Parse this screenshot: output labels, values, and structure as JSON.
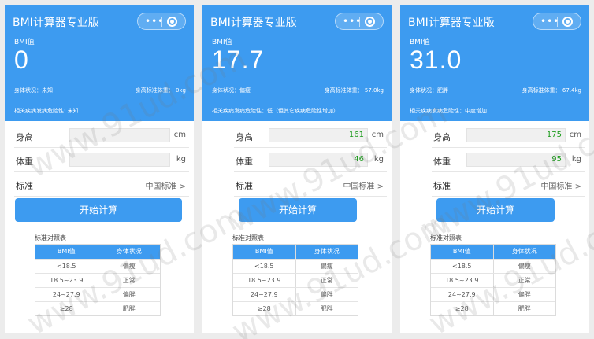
{
  "phones": [
    {
      "app_title": "BMI计算器专业版",
      "capsule": {
        "dots": "•••",
        "menu_icon": "dots-icon",
        "close_icon": "target-icon"
      },
      "bmi_label": "BMI值",
      "bmi_value": "0",
      "status_text": "身体状况：未知",
      "standard_weight_text": "身高标准体重：  0kg",
      "risk_text": "相关疾病发病危险性: 未知",
      "height_label": "身高",
      "height_value": "",
      "height_unit": "cm",
      "weight_label": "体重",
      "weight_value": "",
      "weight_unit": "kg",
      "standard_label": "标准",
      "standard_value": "中国标准 >",
      "calc_button": "开始计算",
      "table_caption": "标准对照表",
      "table_headers": [
        "BMI值",
        "身体状况"
      ],
      "table_rows": [
        [
          "<18.5",
          "偏瘦"
        ],
        [
          "18.5~23.9",
          "正常"
        ],
        [
          "24~27.9",
          "偏胖"
        ],
        [
          "≥28",
          "肥胖"
        ]
      ]
    },
    {
      "app_title": "BMI计算器专业版",
      "capsule": {
        "dots": "•••",
        "menu_icon": "dots-icon",
        "close_icon": "target-icon"
      },
      "bmi_label": "BMI值",
      "bmi_value": "17.7",
      "status_text": "身体状况：偏瘦",
      "standard_weight_text": "身高标准体重：  57.0kg",
      "risk_text": "相关疾病发病危险性：低（但其它疾病危险性增加）",
      "height_label": "身高",
      "height_value": "161",
      "height_unit": "cm",
      "weight_label": "体重",
      "weight_value": "46",
      "weight_unit": "kg",
      "standard_label": "标准",
      "standard_value": "中国标准 >",
      "calc_button": "开始计算",
      "table_caption": "标准对照表",
      "table_headers": [
        "BMI值",
        "身体状况"
      ],
      "table_rows": [
        [
          "<18.5",
          "偏瘦"
        ],
        [
          "18.5~23.9",
          "正常"
        ],
        [
          "24~27.9",
          "偏胖"
        ],
        [
          "≥28",
          "肥胖"
        ]
      ]
    },
    {
      "app_title": "BMI计算器专业版",
      "capsule": {
        "dots": "•••",
        "menu_icon": "dots-icon",
        "close_icon": "target-icon"
      },
      "bmi_label": "BMI值",
      "bmi_value": "31.0",
      "status_text": "身体状况：肥胖",
      "standard_weight_text": "身高标准体重：  67.4kg",
      "risk_text": "相关疾病发病危险性：中度增加",
      "height_label": "身高",
      "height_value": "175",
      "height_unit": "cm",
      "weight_label": "体重",
      "weight_value": "95",
      "weight_unit": "kg",
      "standard_label": "标准",
      "standard_value": "中国标准 >",
      "calc_button": "开始计算",
      "table_caption": "标准对照表",
      "table_headers": [
        "BMI值",
        "身体状况"
      ],
      "table_rows": [
        [
          "<18.5",
          "偏瘦"
        ],
        [
          "18.5~23.9",
          "正常"
        ],
        [
          "24~27.9",
          "偏胖"
        ],
        [
          "≥28",
          "肥胖"
        ]
      ]
    }
  ],
  "watermark": "www.91ud.com",
  "colors": {
    "accent": "#3d9bf0",
    "input_value": "#1a9b1a"
  }
}
